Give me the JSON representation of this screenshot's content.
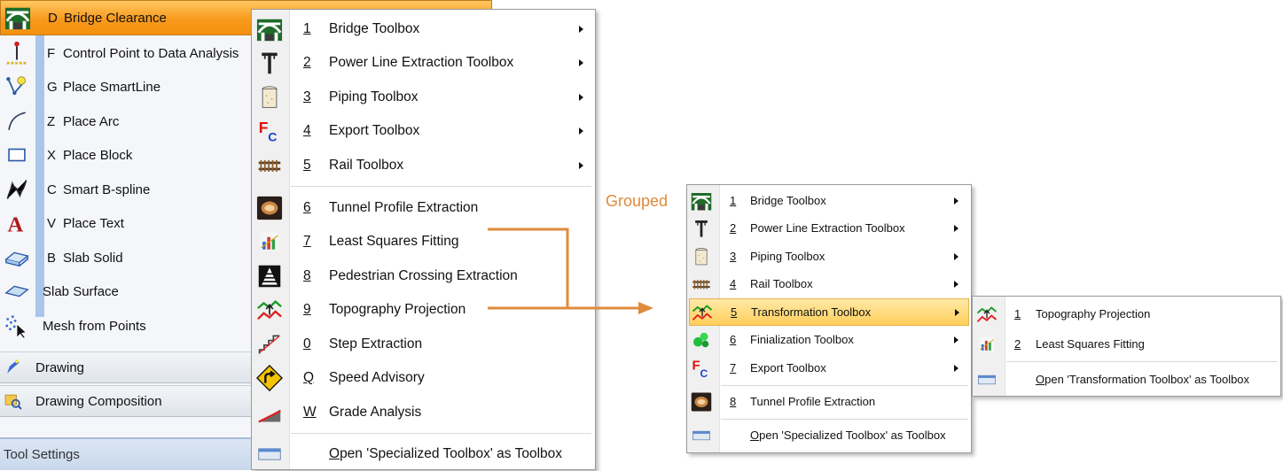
{
  "tool_list": {
    "selected": {
      "key": "D",
      "label": "Bridge Clearance",
      "icon": "bridge-icon"
    },
    "items": [
      {
        "key": "F",
        "label": "Control Point to Data Analysis",
        "icon": "control-point-icon"
      },
      {
        "key": "G",
        "label": "Place SmartLine",
        "icon": "smartline-icon"
      },
      {
        "key": "Z",
        "label": "Place Arc",
        "icon": "arc-icon"
      },
      {
        "key": "X",
        "label": "Place Block",
        "icon": "block-icon"
      },
      {
        "key": "C",
        "label": "Smart B-spline",
        "icon": "bspline-icon"
      },
      {
        "key": "V",
        "label": "Place Text",
        "icon": "text-icon"
      },
      {
        "key": "B",
        "label": "Slab Solid",
        "icon": "slab-solid-icon"
      },
      {
        "key": "",
        "label": "Slab Surface",
        "icon": "slab-surface-icon"
      },
      {
        "key": "",
        "label": "Mesh from Points",
        "icon": "mesh-points-icon"
      }
    ],
    "sections": [
      {
        "label": "Drawing",
        "icon": "drawing-icon"
      },
      {
        "label": "Drawing Composition",
        "icon": "drawing-composition-icon"
      }
    ],
    "tool_settings": "Tool Settings"
  },
  "specialized_menu": {
    "items": [
      {
        "key": "1",
        "label": "Bridge Toolbox",
        "icon": "bridge-icon",
        "submenu": true
      },
      {
        "key": "2",
        "label": "Power Line Extraction Toolbox",
        "icon": "power-line-icon",
        "submenu": true
      },
      {
        "key": "3",
        "label": "Piping Toolbox",
        "icon": "piping-icon",
        "submenu": true
      },
      {
        "key": "4",
        "label": "Export Toolbox",
        "icon": "export-fc-icon",
        "submenu": true
      },
      {
        "key": "5",
        "label": "Rail Toolbox",
        "icon": "rail-icon",
        "submenu": true
      },
      {
        "key": "6",
        "label": "Tunnel Profile Extraction",
        "icon": "tunnel-icon",
        "submenu": false
      },
      {
        "key": "7",
        "label": "Least Squares Fitting",
        "icon": "least-squares-icon",
        "submenu": false
      },
      {
        "key": "8",
        "label": "Pedestrian Crossing Extraction",
        "icon": "pedestrian-crossing-icon",
        "submenu": false
      },
      {
        "key": "9",
        "label": "Topography Projection",
        "icon": "topography-icon",
        "submenu": false
      },
      {
        "key": "0",
        "label": "Step Extraction",
        "icon": "step-icon",
        "submenu": false
      },
      {
        "key": "Q",
        "label": "Speed Advisory",
        "icon": "speed-advisory-icon",
        "submenu": false
      },
      {
        "key": "W",
        "label": "Grade Analysis",
        "icon": "grade-icon",
        "submenu": false
      }
    ],
    "open_as_toolbox": {
      "key": "O",
      "label": "pen 'Specialized Toolbox' as Toolbox",
      "icon": "toolbox-icon"
    }
  },
  "grouped_label": "Grouped",
  "grouped_menu": {
    "items": [
      {
        "key": "1",
        "label": "Bridge Toolbox",
        "icon": "bridge-icon",
        "submenu": true
      },
      {
        "key": "2",
        "label": "Power Line Extraction Toolbox",
        "icon": "power-line-icon",
        "submenu": true
      },
      {
        "key": "3",
        "label": "Piping Toolbox",
        "icon": "piping-icon",
        "submenu": true
      },
      {
        "key": "4",
        "label": "Rail Toolbox",
        "icon": "rail-icon",
        "submenu": true
      },
      {
        "key": "5",
        "label": "Transformation Toolbox",
        "icon": "topography-icon",
        "submenu": true,
        "highlighted": true
      },
      {
        "key": "6",
        "label": "Finialization Toolbox",
        "icon": "finalization-icon",
        "submenu": true
      },
      {
        "key": "7",
        "label": "Export Toolbox",
        "icon": "export-fc-icon",
        "submenu": true
      },
      {
        "key": "8",
        "label": "Tunnel Profile Extraction",
        "icon": "tunnel-icon",
        "submenu": false
      }
    ],
    "open_as_toolbox": {
      "key": "O",
      "label": "pen 'Specialized Toolbox' as Toolbox",
      "icon": "toolbox-icon"
    }
  },
  "transformation_submenu": {
    "items": [
      {
        "key": "1",
        "label": "Topography Projection",
        "icon": "topography-icon"
      },
      {
        "key": "2",
        "label": "Least Squares Fitting",
        "icon": "least-squares-icon"
      }
    ],
    "open_as_toolbox": {
      "key": "O",
      "label": "pen 'Transformation Toolbox' as Toolbox",
      "icon": "toolbox-icon"
    }
  },
  "colors": {
    "accent_orange": "#f4900e",
    "arrow": "#e08a3c",
    "highlight": "#ffcf5a"
  }
}
